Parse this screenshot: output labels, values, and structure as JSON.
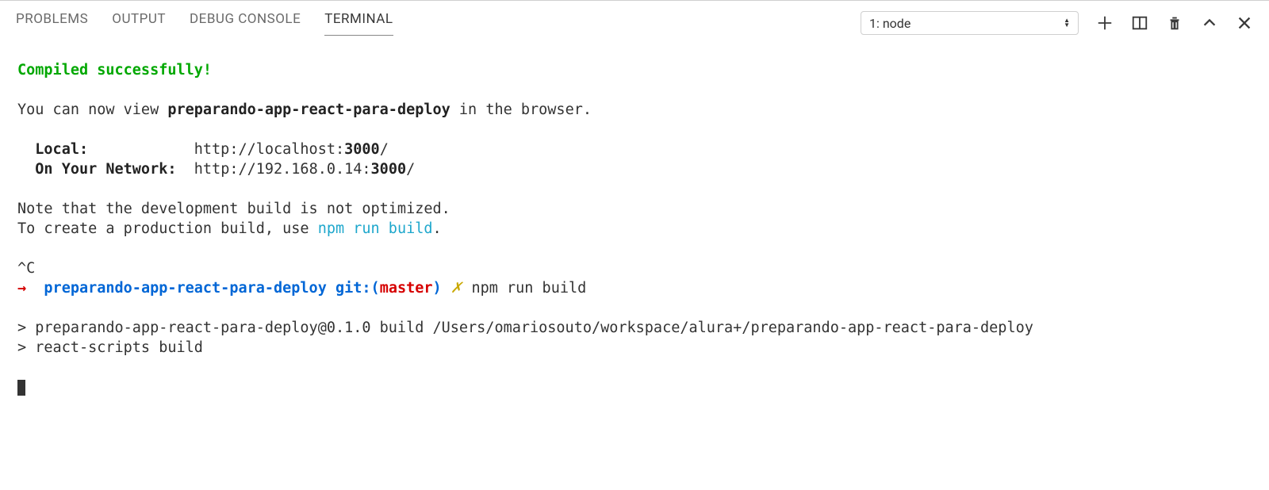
{
  "tabs": {
    "problems": "PROBLEMS",
    "output": "OUTPUT",
    "debugConsole": "DEBUG CONSOLE",
    "terminal": "TERMINAL"
  },
  "terminalSelect": "1: node",
  "output": {
    "compiled": "Compiled successfully!",
    "viewPrefix": "You can now view ",
    "appName": "preparando-app-react-para-deploy",
    "viewSuffix": " in the browser.",
    "localLabel": "Local:",
    "localUrlPrefix": "http://localhost:",
    "localPort": "3000",
    "localUrlSuffix": "/",
    "networkLabel": "On Your Network:",
    "networkUrlPrefix": "http://192.168.0.14:",
    "networkPort": "3000",
    "networkUrlSuffix": "/",
    "noteLine1": "Note that the development build is not optimized.",
    "noteLine2Prefix": "To create a production build, use ",
    "npmRunBuild": "npm run build",
    "noteLine2Suffix": ".",
    "ctrlC": "^C",
    "promptArrow": "→",
    "promptDir": "preparando-app-react-para-deploy",
    "gitLabel": "git:(",
    "gitBranch": "master",
    "gitClose": ")",
    "dirtyMark": "✗",
    "command": "npm run build",
    "scriptLine1": "> preparando-app-react-para-deploy@0.1.0 build /Users/omariosouto/workspace/alura+/preparando-app-react-para-deploy",
    "scriptLine2": "> react-scripts build"
  }
}
